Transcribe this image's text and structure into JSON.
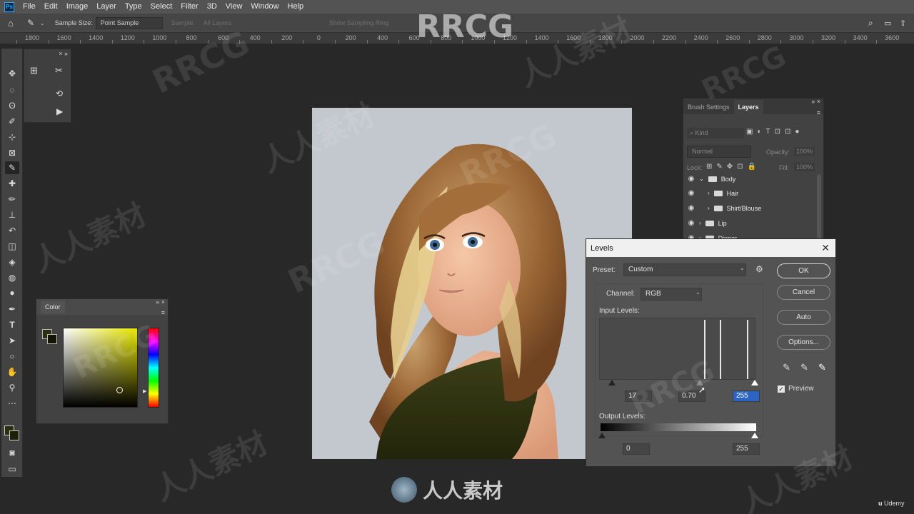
{
  "app": {
    "logo": "Ps"
  },
  "menu": [
    "File",
    "Edit",
    "Image",
    "Layer",
    "Type",
    "Select",
    "Filter",
    "3D",
    "View",
    "Window",
    "Help"
  ],
  "options_bar": {
    "tool_icon": "eyedropper-icon",
    "sample_size_label": "Sample Size:",
    "sample_size_value": "Point Sample",
    "sample_label": "Sample:",
    "sample_value": "All Layers",
    "show_ring": "Show Sampling Ring"
  },
  "ruler": [
    "1800",
    "1600",
    "1400",
    "1200",
    "1000",
    "800",
    "600",
    "400",
    "200",
    "0",
    "200",
    "400",
    "600",
    "800",
    "1000",
    "1200",
    "1400",
    "1600",
    "1800",
    "2000",
    "2200",
    "2400",
    "2600",
    "2800",
    "3000",
    "3200",
    "3400",
    "3600"
  ],
  "color_panel": {
    "tab": "Color"
  },
  "layers_panel": {
    "tabs": [
      "Brush Settings",
      "Layers"
    ],
    "kind_placeholder": "Kind",
    "blend_mode": "Normal",
    "opacity_label": "Opacity:",
    "opacity_value": "100%",
    "lock_label": "Lock:",
    "fill_label": "Fill:",
    "fill_value": "100%",
    "layers": [
      "Body",
      "Hair",
      "Shirt/Blouse",
      "Lip",
      "Dinner"
    ]
  },
  "levels_dialog": {
    "title": "Levels",
    "preset_label": "Preset:",
    "preset_value": "Custom",
    "channel_label": "Channel:",
    "channel_value": "RGB",
    "input_levels_label": "Input Levels:",
    "input_black": "17",
    "input_gamma": "0.70",
    "input_white": "255",
    "output_levels_label": "Output Levels:",
    "output_black": "0",
    "output_white": "255",
    "buttons": {
      "ok": "OK",
      "cancel": "Cancel",
      "auto": "Auto",
      "options": "Options..."
    },
    "preview_label": "Preview",
    "preview_checked": true
  },
  "watermarks": {
    "brand": "RRCG",
    "cn": "人人素材",
    "udemy": "Udemy"
  }
}
